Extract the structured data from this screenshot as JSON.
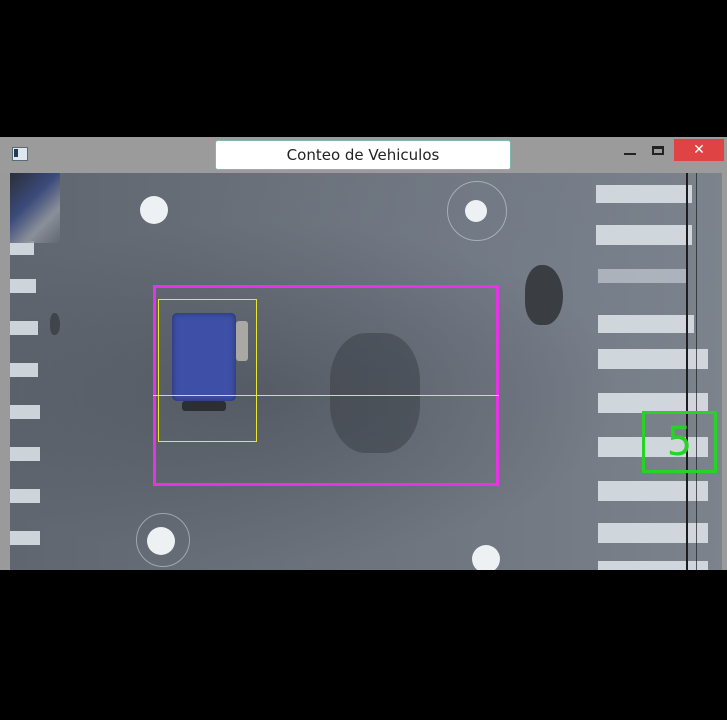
{
  "window": {
    "title": "Conteo de Vehiculos",
    "close_symbol": "✕"
  },
  "overlay": {
    "vehicle_count": "5",
    "colors": {
      "zone": "#e434e4",
      "detection": "#e9e62c",
      "counter": "#27d327"
    }
  },
  "icons": {
    "app": "app-window-icon",
    "minimize": "minimize-icon",
    "maximize": "maximize-icon",
    "close": "close-icon"
  }
}
